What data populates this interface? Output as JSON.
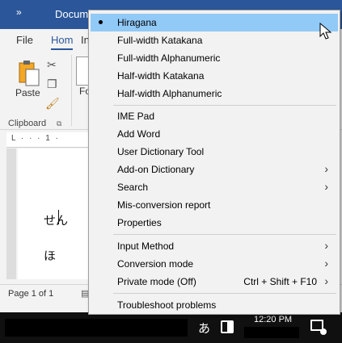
{
  "title_bar": {
    "quick_access": "»",
    "document": "Docum"
  },
  "ribbon_tabs": [
    "File",
    "Hom",
    "In"
  ],
  "clipboard": {
    "paste_label": "Paste",
    "group_label": "Clipboard",
    "font_label": "Fo"
  },
  "ruler_text": "L  ·  · ·  1 ·",
  "document_text": {
    "line1": "せん",
    "line2": "ほ"
  },
  "status_bar": {
    "page": "Page 1 of 1"
  },
  "taskbar": {
    "ime_mode": "あ",
    "time": "12:20 PM"
  },
  "menu": {
    "input_modes": [
      {
        "label": "Hiragana",
        "checked": true
      },
      {
        "label": "Full-width Katakana"
      },
      {
        "label": "Full-width Alphanumeric"
      },
      {
        "label": "Half-width Katakana"
      },
      {
        "label": "Half-width Alphanumeric"
      }
    ],
    "tools": [
      {
        "label": "IME Pad"
      },
      {
        "label": "Add Word"
      },
      {
        "label": "User Dictionary Tool"
      },
      {
        "label": "Add-on Dictionary",
        "submenu": true
      },
      {
        "label": "Search",
        "submenu": true
      },
      {
        "label": "Mis-conversion report"
      },
      {
        "label": "Properties"
      }
    ],
    "settings": [
      {
        "label": "Input Method",
        "submenu": true
      },
      {
        "label": "Conversion mode",
        "submenu": true
      },
      {
        "label": "Private mode (Off)",
        "shortcut": "Ctrl + Shift + F10",
        "submenu": true
      }
    ],
    "footer": [
      {
        "label": "Troubleshoot problems"
      }
    ],
    "submenu_arrow": "›",
    "highlight_color": "#91c9f7"
  }
}
